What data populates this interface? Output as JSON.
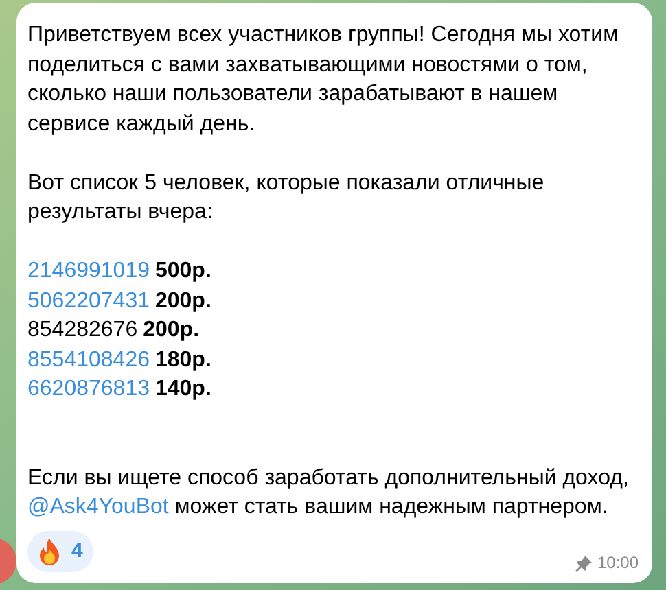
{
  "message": {
    "paragraphs": [
      "Приветствуем всех участников группы! Сегодня мы хотим поделиться с вами захватывающими новостями о том, сколько наши пользователи зарабатывают в нашем сервисе каждый день.",
      "Вот список 5 человек, которые показали отличные результаты вчера:"
    ],
    "entries": [
      {
        "id": "2146991019",
        "linked": true,
        "amount": "500р."
      },
      {
        "id": "5062207431",
        "linked": true,
        "amount": "200р."
      },
      {
        "id": "854282676",
        "linked": false,
        "amount": "200р."
      },
      {
        "id": "8554108426",
        "linked": true,
        "amount": "180р."
      },
      {
        "id": "6620876813",
        "linked": true,
        "amount": "140р."
      }
    ],
    "closing": {
      "before": "Если вы ищете способ заработать дополнительный доход,",
      "mention": "@Ask4YouBot",
      "after": "может стать вашим надежным партнером."
    },
    "reaction": {
      "count": "4"
    },
    "pinned": true,
    "time": "10:00"
  }
}
